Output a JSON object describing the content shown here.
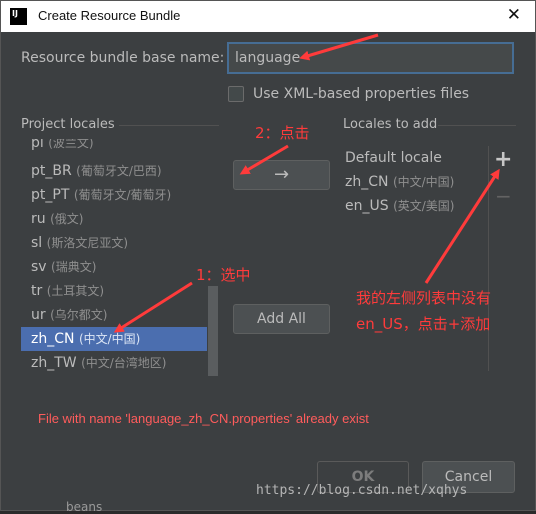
{
  "window": {
    "title": "Create Resource Bundle",
    "icon_text": "IJ",
    "close_glyph": "✕"
  },
  "base_name": {
    "label": "Resource bundle base name:",
    "value": "language"
  },
  "xml_option": {
    "label": "Use XML-based properties files",
    "checked": false
  },
  "project_locales": {
    "header": "Project locales",
    "items": [
      {
        "code": "pl",
        "name": "(波兰文)",
        "selected": false
      },
      {
        "code": "pt_BR",
        "name": "(葡萄牙文/巴西)",
        "selected": false
      },
      {
        "code": "pt_PT",
        "name": "(葡萄牙文/葡萄牙)",
        "selected": false
      },
      {
        "code": "ru",
        "name": "(俄文)",
        "selected": false
      },
      {
        "code": "sl",
        "name": "(斯洛文尼亚文)",
        "selected": false
      },
      {
        "code": "sv",
        "name": "(瑞典文)",
        "selected": false
      },
      {
        "code": "tr",
        "name": "(土耳其文)",
        "selected": false
      },
      {
        "code": "ur",
        "name": "(乌尔都文)",
        "selected": false
      },
      {
        "code": "zh_CN",
        "name": "(中文/中国)",
        "selected": true
      },
      {
        "code": "zh_TW",
        "name": "(中文/台湾地区)",
        "selected": false
      }
    ]
  },
  "locales_to_add": {
    "header": "Locales to add",
    "items": [
      {
        "code": "Default locale",
        "name": ""
      },
      {
        "code": "zh_CN",
        "name": "(中文/中国)"
      },
      {
        "code": "en_US",
        "name": "(英文/美国)"
      }
    ],
    "add_glyph": "+",
    "remove_glyph": "−"
  },
  "buttons": {
    "move_glyph": "→",
    "add_all": "Add All",
    "ok": "OK",
    "cancel": "Cancel"
  },
  "error_text": "File with name 'language_zh_CN.properties' already exist",
  "annotations": {
    "step1": "1：选中",
    "step2": "2：点击",
    "note_line1": "我的左侧列表中没有",
    "note_line2": "en_US，点击+添加"
  },
  "watermark": "https://blog.csdn.net/xqhys",
  "background_text": "beans",
  "colors": {
    "dialog_bg": "#3c3f41",
    "selection": "#4b6eaf",
    "error": "#ff5c5c",
    "annotation": "#ff3b3b",
    "input_border": "#466d94"
  }
}
